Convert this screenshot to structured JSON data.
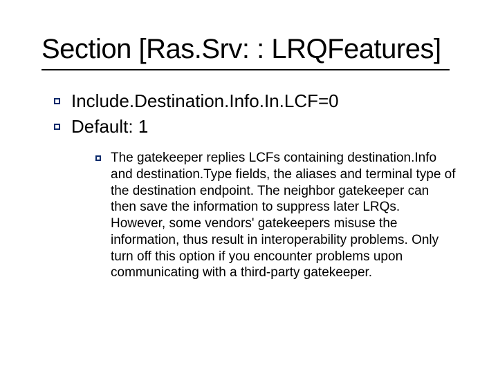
{
  "title": "Section [Ras.Srv: : LRQFeatures]",
  "bullets": {
    "line1": "Include.Destination.Info.In.LCF=0",
    "line2": "Default: 1",
    "detail": "The gatekeeper replies LCFs containing destination.Info and destination.Type fields, the aliases and terminal type of the destination endpoint. The neighbor gatekeeper can then save the information to suppress later LRQs. However, some vendors' gatekeepers misuse the information, thus result in interoperability problems. Only turn off this option if you encounter problems upon communicating with a third-party gatekeeper."
  }
}
